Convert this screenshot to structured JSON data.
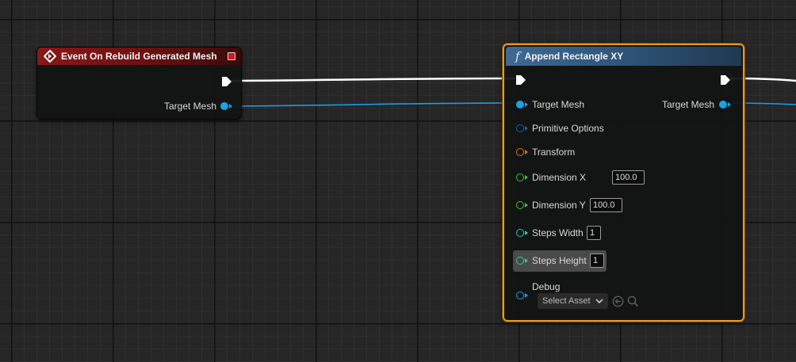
{
  "event_node": {
    "title": "Event On Rebuild Generated Mesh",
    "output_pin": "Target Mesh"
  },
  "func_node": {
    "title": "Append Rectangle XY",
    "func_icon": "f",
    "inputs": {
      "target_mesh": "Target Mesh",
      "primitive_options": "Primitive Options",
      "transform": "Transform",
      "dimension_x": "Dimension X",
      "dimension_x_value": "100.0",
      "dimension_y": "Dimension Y",
      "dimension_y_value": "100.0",
      "steps_width": "Steps Width",
      "steps_width_value": "1",
      "steps_height": "Steps Height",
      "steps_height_value": "1",
      "debug": "Debug",
      "debug_select": "Select Asset"
    },
    "output_pin": "Target Mesh"
  },
  "colors": {
    "exec": "#ffffff",
    "mesh_pin": "#1aa1e8",
    "struct_pin": "#0f5fb0",
    "transform_pin": "#e07020",
    "float_pin": "#37c837",
    "int_pin": "#1fd3a0",
    "debug_pin": "#1aa1e8",
    "selection": "#e89a1e"
  }
}
